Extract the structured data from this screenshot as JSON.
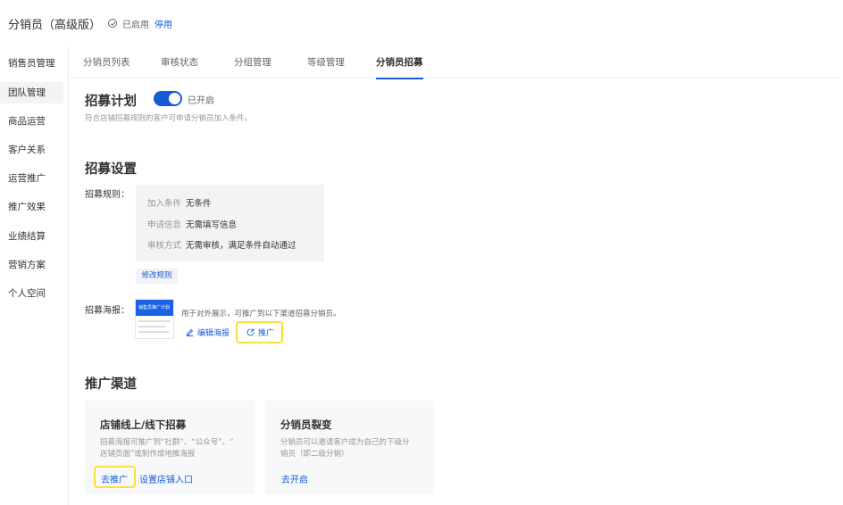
{
  "header": {
    "title": "分销员（高级版）",
    "status_icon": "check-circle-icon",
    "status_text": "已启用",
    "disable_link": "停用"
  },
  "sidebar": {
    "items": [
      {
        "label": "销售员管理",
        "active": false
      },
      {
        "label": "团队管理",
        "active": true
      },
      {
        "label": "商品运营",
        "active": false
      },
      {
        "label": "客户关系",
        "active": false
      },
      {
        "label": "运营推广",
        "active": false
      },
      {
        "label": "推广效果",
        "active": false
      },
      {
        "label": "业绩结算",
        "active": false
      },
      {
        "label": "营销方案",
        "active": false
      },
      {
        "label": "个人空间",
        "active": false
      }
    ]
  },
  "tabs": [
    {
      "label": "分销员列表"
    },
    {
      "label": "审核状态"
    },
    {
      "label": "分组管理"
    },
    {
      "label": "等级管理"
    },
    {
      "label": "分销员招募",
      "active": true
    }
  ],
  "plan": {
    "title": "招募计划",
    "toggle_on": true,
    "toggle_label": "已开启",
    "desc": "符合店铺招募规则的客户可申请分销员加入条件。"
  },
  "settings": {
    "title": "招募设置",
    "rules_label": "招募规则：",
    "rules": [
      {
        "key": "加入条件",
        "value": "无条件"
      },
      {
        "key": "申请信息",
        "value": "无需填写信息"
      },
      {
        "key": "审核方式",
        "value": "无需审核，满足条件自动通过"
      }
    ],
    "edit_rules_button": "修改规则",
    "poster_label": "招募海报：",
    "poster_thumb_text": "销售员推广计划",
    "poster_desc": "用于对外展示，可推广到以下渠道招募分销员。",
    "edit_poster": "编辑海报",
    "promote": "推广"
  },
  "channels": {
    "title": "推广渠道",
    "cards": [
      {
        "title": "店铺线上/线下招募",
        "desc_lines": [
          "招募海报可推广到“社群”、“公众号”、“",
          "店铺页面”或制作成地推海报"
        ],
        "links": [
          "去推广",
          "设置店铺入口"
        ]
      },
      {
        "title": "分销员裂变",
        "desc_lines": [
          "分销员可以邀请客户成为自己的下级分",
          "销员（即二级分销）"
        ],
        "links": [
          "去开启"
        ]
      }
    ]
  },
  "colors": {
    "accent": "#155bd4",
    "highlight": "#f8e13a"
  }
}
